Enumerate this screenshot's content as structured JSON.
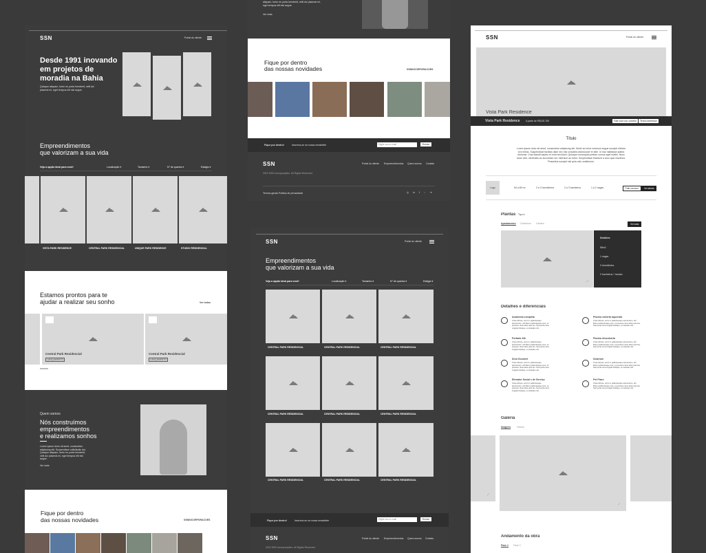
{
  "brand": "SSN",
  "header": {
    "portal": "Portal do cliente",
    "portal_short": "Portal do cliente"
  },
  "hero": {
    "title_1": "Desde 1991 inovando",
    "title_2": "em projetos de",
    "title_3": "moradia na Bahia",
    "desc": "Quisque aliquam, tortor eu porta hendrerit, velit dui placerat mi, eget tempus elit nisl augue."
  },
  "emp": {
    "title_1": "Empreendimentos",
    "title_2": "que valorizam a sua vida",
    "filter_label": "Veja a opção ideal para você!",
    "filters": [
      "Localização ▾",
      "Tamanho ▾",
      "N° de quartos ▾",
      "Estágio ▾"
    ],
    "cards": [
      "VISTA PARK RESIDENCE",
      "CENTRAL PARK RESIDENCIAL",
      "UNIQUE PARK RESIDENCE",
      "STUDIO RESIDENCIAL"
    ],
    "grid_caption": "CENTRAL PARK RESIDENCIAL"
  },
  "ready": {
    "title_1": "Estamos prontos para te",
    "title_2": "ajudar a realizar seu sonho",
    "see_all": "Ver todos",
    "cards": [
      {
        "name": "Central Park Residencial",
        "tag": "LANÇAMENTO"
      },
      {
        "name": "Central Park Residencial",
        "tag": "LANÇAMENTO"
      }
    ]
  },
  "about": {
    "kicker": "Quem somos",
    "title_1": "Nós construímos",
    "title_2": "empreendimentos",
    "title_3": "e realizamos sonhos",
    "desc": "Lorem ipsum dolor sit amet, consectetur adipiscing elit. Suspendisse sollicitudin dui. Quisque aliquam, tortor eu porta hendrerit, velit dui placerat mi, eget tempus elit nisl augue.",
    "more": "Ver mais"
  },
  "news": {
    "title_1": "Fique por dentro",
    "title_2": "das nossas novidades",
    "handle": "SSNINCORPORACOES"
  },
  "newsletter": {
    "label": "Fique por dentro!",
    "desc": "Inscreva-se na nossa newsletter",
    "placeholder": "Digite seu e-mail",
    "button": "Enviar"
  },
  "footer": {
    "links": [
      "Portal do cliente",
      "Empreendimentos",
      "Quem somos",
      "Contato"
    ],
    "copyright": "2022 SSN Incorporações. All Rights Reserved.",
    "legal_1": "Termos gerais",
    "legal_2": "Política de privacidade"
  },
  "top_fragment": {
    "text": "aliquam, tortor eu porta hendrerit, velit dui placerat mi, eget tempus elit nisl augue.",
    "more": "Ver mais"
  },
  "detail": {
    "name": "Vista Park Residence",
    "price": "A partir de R$125.750",
    "btn_1": "Fale com um corretor",
    "btn_2": "Tenho interesse",
    "section_title": "Título",
    "section_text": "Lorem ipsum dolor sit amet, consectetur adipiscing elit. Morbi ac tortor euismod augue suscipit ultrices id id tellus. Suspendisse facilisis diam nec nisi convallis ullamcorper et nibh. In hac habitasse platea dictumst. Cras blandit sapien et enim tincidunt. Quisque consequat pretium cursus eget mattis. Nunc dolor velit, venenatis ac accumsan vel, interdum ac tortor. Suspendisse tincidunt a arcu quis maximus. Phasellus suscipit nisi quis odio vestibulum.",
    "logo": "Logo",
    "specs": [
      "54 a 89 m²",
      "2 a 3 dormitórios",
      "2 a 3 banheiros",
      "1 a 2 vagas"
    ],
    "spec_btn_1": "Fale conosco",
    "spec_btn_2": "Ver tabela",
    "plantas": "Plantas",
    "tipo": "Tipo ▾",
    "tabs": [
      "Apartamento",
      "Cobertura",
      "Garden"
    ],
    "ver_mais": "Ver mais",
    "details_title": "Detalhes",
    "details_items": [
      "58m2",
      "1 vagas",
      "3 dormitórios",
      "2 banheiros + lavabo"
    ],
    "dif_title": "Detalhes e diferenciais",
    "features": [
      "Academia completa",
      "Piscina coberta aquecida",
      "Portaria 24h",
      "Piscina descoberta",
      "Área Gourmet",
      "Solarium",
      "Elevador Social e de Serviço",
      "Pet Place"
    ],
    "feature_desc": "Cras ultrices, enim in pellentesque elementum, elit libero pellentesque eros, ut posuere risus ellus quis leo. Sed porta urna a ligula tristique, a molestie nisl.",
    "gallery": "Galeria",
    "gallery_tabs": [
      "Imagens",
      "Vídeos"
    ],
    "obra": "Andamento da obra",
    "fase_tabs": [
      "Fase 1",
      "Fase 2"
    ]
  }
}
